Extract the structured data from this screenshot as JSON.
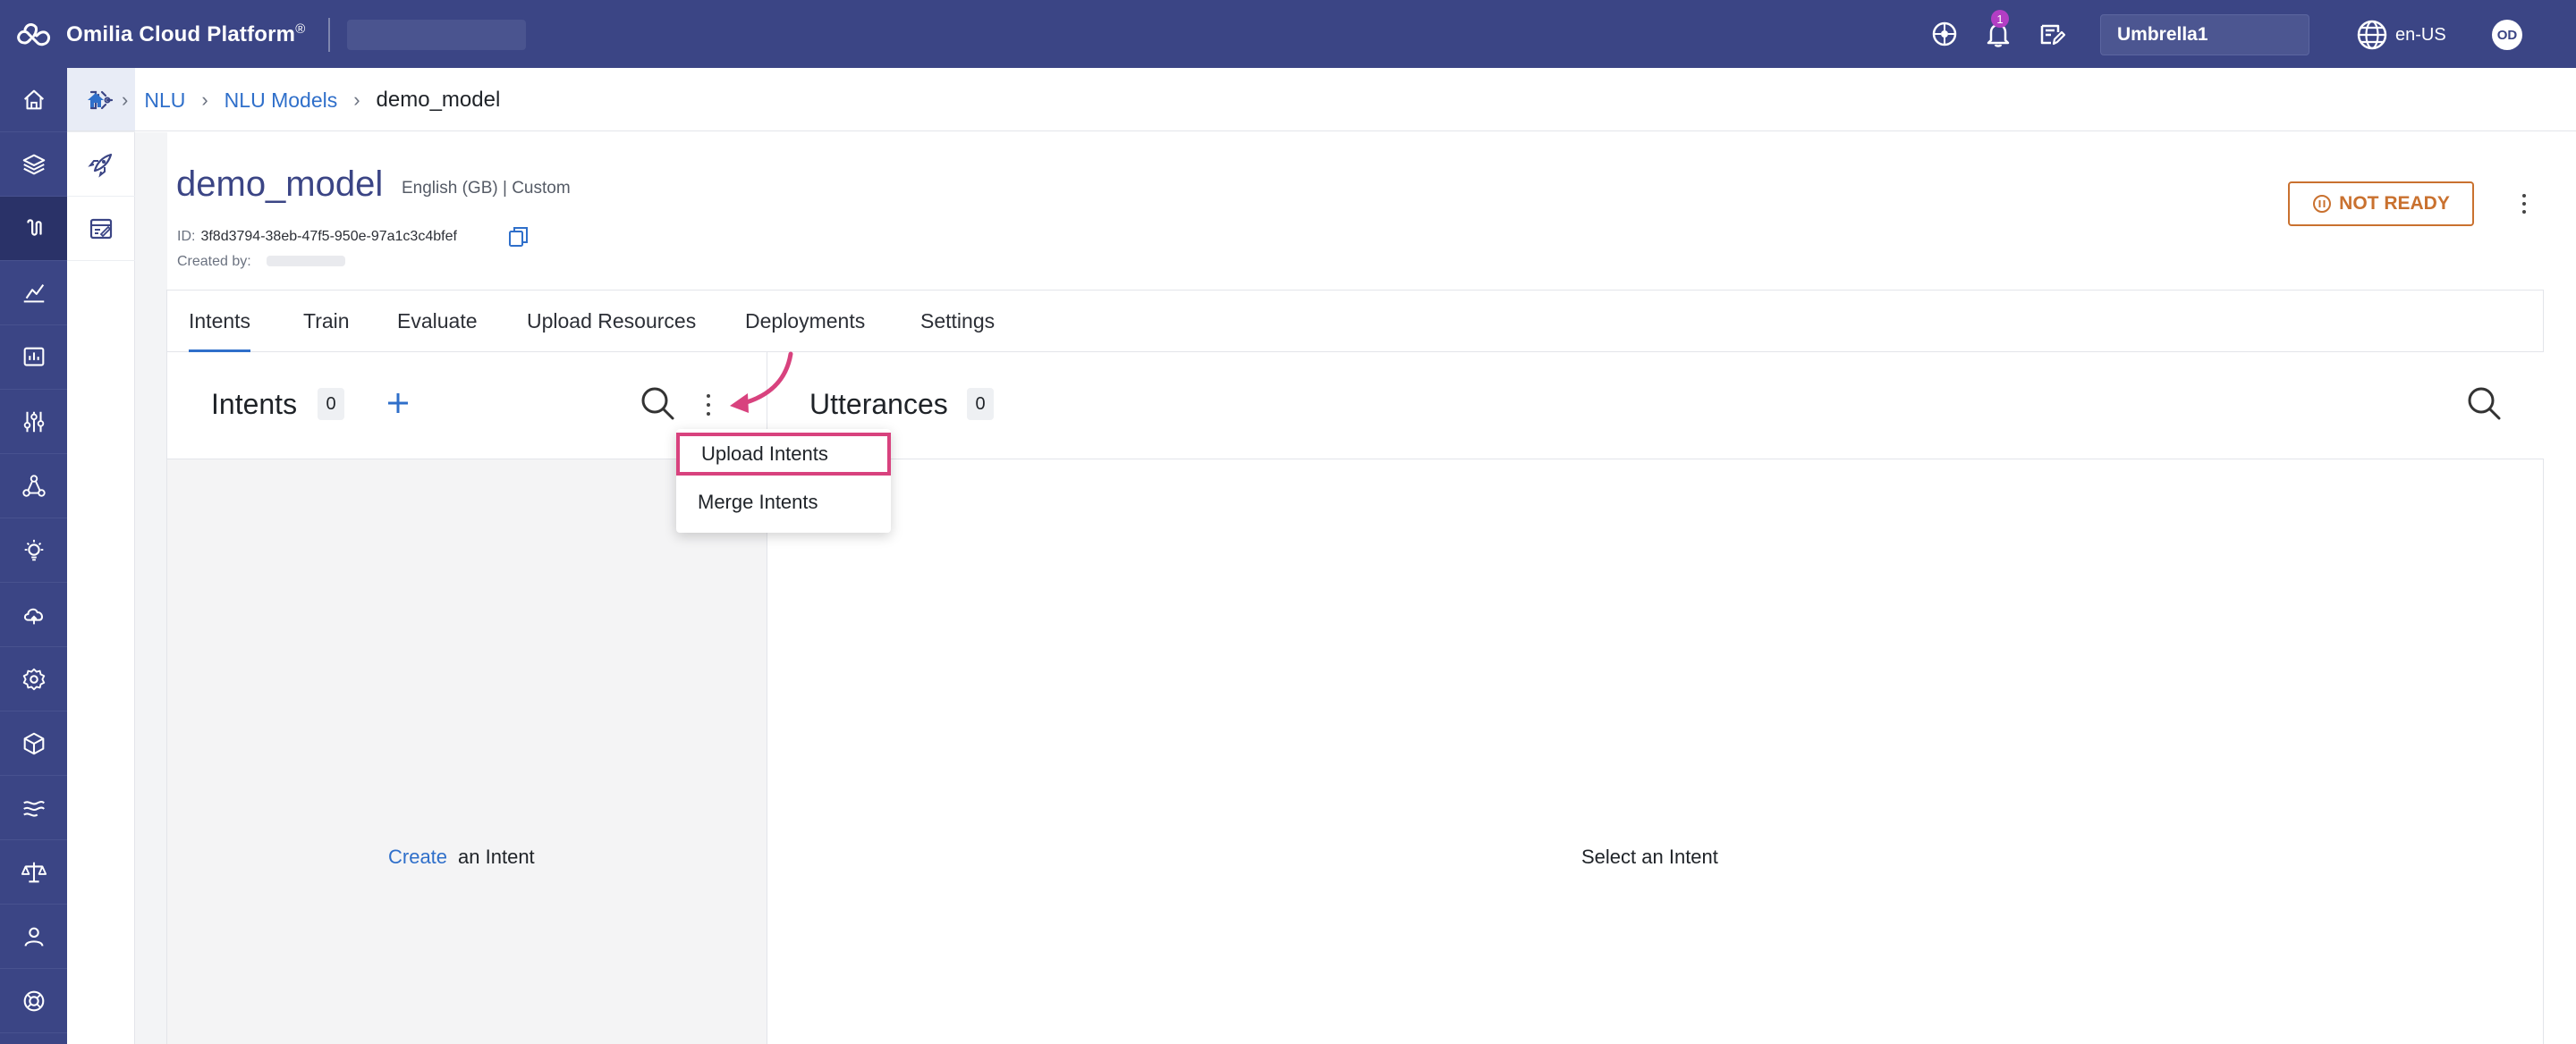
{
  "topbar": {
    "app_title": "Omilia Cloud Platform",
    "app_title_mark": "®",
    "notification_count": "1",
    "account": "Umbrella1",
    "language": "en-US",
    "avatar_initials": "OD"
  },
  "rail": {
    "icons": [
      "home-icon",
      "layers-icon",
      "nlu-icon",
      "analytics-icon",
      "reports-icon",
      "settings-sliders-icon",
      "network-icon",
      "insights-icon",
      "cloud-icon",
      "gear-icon",
      "box-icon",
      "flows-icon",
      "balance-icon",
      "user-icon",
      "support-icon"
    ],
    "active_index": 2
  },
  "subrail": {
    "icons": [
      "model-icon",
      "deploy-rocket-icon",
      "evaluate-icon"
    ],
    "active_index": 0
  },
  "breadcrumb": {
    "home": "home",
    "items": [
      "NLU",
      "NLU Models"
    ],
    "current": "demo_model"
  },
  "model": {
    "name": "demo_model",
    "meta": "English (GB) | Custom",
    "id_label": "ID:",
    "id_value": "3f8d3794-38eb-47f5-950e-97a1c3c4bfef",
    "created_by_label": "Created by:",
    "status": "NOT READY"
  },
  "tabs": [
    "Intents",
    "Train",
    "Evaluate",
    "Upload Resources",
    "Deployments",
    "Settings"
  ],
  "active_tab": "Intents",
  "intents": {
    "title": "Intents",
    "count": "0",
    "empty_link": "Create",
    "empty_text": "an Intent"
  },
  "utterances": {
    "title": "Utterances",
    "count": "0",
    "empty_text": "Select an Intent"
  },
  "menu": {
    "items": [
      "Upload Intents",
      "Merge Intents"
    ]
  },
  "colors": {
    "brand": "#3b4585",
    "link": "#2f6fca",
    "status": "#c9712f",
    "highlight": "#d8427e"
  }
}
